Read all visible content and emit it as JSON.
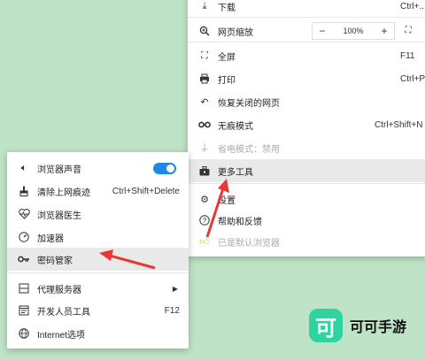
{
  "main_menu": {
    "download": {
      "label": "下载",
      "shortcut": "Ctrl+..."
    },
    "zoom": {
      "label": "网页缩放",
      "minus": "−",
      "value": "100%",
      "plus": "+"
    },
    "fullscreen": {
      "label": "全屏",
      "shortcut": "F11"
    },
    "print": {
      "label": "打印",
      "shortcut": "Ctrl+P"
    },
    "restore": {
      "label": "恢复关闭的网页"
    },
    "incognito": {
      "label": "无痕模式",
      "shortcut": "Ctrl+Shift+N"
    },
    "compat": {
      "label": "省电模式：禁用"
    },
    "more_tools": {
      "label": "更多工具"
    },
    "settings": {
      "label": "设置"
    },
    "help": {
      "label": "帮助和反馈"
    },
    "default_browser": {
      "label": "已是默认浏览器"
    }
  },
  "sub_menu": {
    "sound": {
      "label": "浏览器声音",
      "enabled": true
    },
    "clear": {
      "label": "清除上网痕迹",
      "shortcut": "Ctrl+Shift+Delete"
    },
    "doctor": {
      "label": "浏览器医生"
    },
    "accelerator": {
      "label": "加速器"
    },
    "password": {
      "label": "密码管家"
    },
    "proxy": {
      "label": "代理服务器"
    },
    "devtools": {
      "label": "开发人员工具",
      "shortcut": "F12"
    },
    "internet_options": {
      "label": "Internet选项"
    }
  },
  "watermark": {
    "logo": "可",
    "text": "可可手游"
  },
  "colors": {
    "background": "#bfe3c6",
    "accent": "#1e88e5",
    "arrow": "#e53935",
    "watermark": "#2fd39f"
  }
}
